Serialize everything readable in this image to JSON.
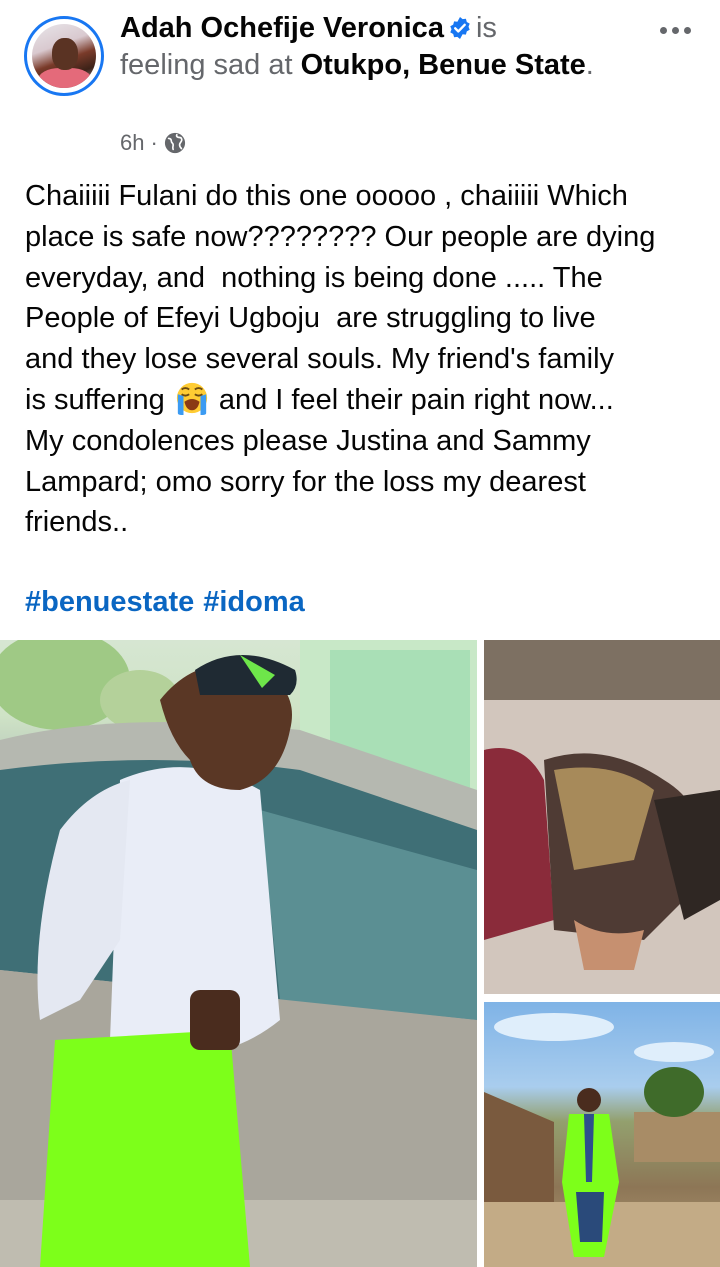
{
  "post": {
    "author": "Adah Ochefije Veronica",
    "activity_is": "is",
    "activity_feeling": "feeling sad at",
    "location": "Otukpo, Benue State",
    "location_end": ".",
    "time": "6h",
    "separator": "·",
    "audience_icon": "globe-icon",
    "text_part1": "Chaiiiii Fulani do this one ooooo , chaiiiii Which\nplace is safe now???????? Our people are dying\neveryday, and  nothing is being done ..... The\nPeople of Efeyi Ugboju  are struggling to live\nand they lose several souls. My friend's family\nis suffering ",
    "text_part2": " and I feel their pain right now...\nMy condolences please Justina and Sammy\nLampard; omo sorry for the loss my dearest\nfriends..",
    "emoji": "loudly-crying-face-emoji",
    "hashtags": [
      "#benuestate",
      "#idoma"
    ]
  },
  "colors": {
    "link": "#0a66c2",
    "verified": "#1877f2",
    "secondary_text": "#65676b",
    "lime_green": "#7dff1a"
  }
}
